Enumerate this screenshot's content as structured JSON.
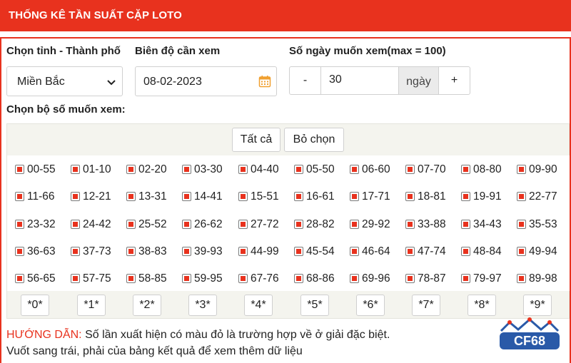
{
  "header": {
    "title": "THỐNG KÊ TẦN SUẤT CẶP LOTO"
  },
  "form": {
    "province_label": "Chọn tỉnh - Thành phố",
    "province_value": "Miền Bắc",
    "range_label": "Biên độ cần xem",
    "date_value": "08-02-2023",
    "days_label": "Số ngày muốn xem(max = 100)",
    "minus_label": "-",
    "days_value": "30",
    "days_unit": "ngày",
    "plus_label": "+"
  },
  "picker": {
    "title": "Chọn bộ số muốn xem:",
    "select_all": "Tất cả",
    "deselect": "Bỏ chọn",
    "rows": [
      [
        "00-55",
        "01-10",
        "02-20",
        "03-30",
        "04-40",
        "05-50",
        "06-60",
        "07-70",
        "08-80",
        "09-90"
      ],
      [
        "11-66",
        "12-21",
        "13-31",
        "14-41",
        "15-51",
        "16-61",
        "17-71",
        "18-81",
        "19-91",
        "22-77"
      ],
      [
        "23-32",
        "24-42",
        "25-52",
        "26-62",
        "27-72",
        "28-82",
        "29-92",
        "33-88",
        "34-43",
        "35-53"
      ],
      [
        "36-63",
        "37-73",
        "38-83",
        "39-93",
        "44-99",
        "45-54",
        "46-64",
        "47-74",
        "48-84",
        "49-94"
      ],
      [
        "56-65",
        "57-75",
        "58-85",
        "59-95",
        "67-76",
        "68-86",
        "69-96",
        "78-87",
        "79-97",
        "89-98"
      ]
    ],
    "tails": [
      "*0*",
      "*1*",
      "*2*",
      "*3*",
      "*4*",
      "*5*",
      "*6*",
      "*7*",
      "*8*",
      "*9*"
    ]
  },
  "guide": {
    "heading": "HƯỚNG DẪN:",
    "line1": "Số lần xuất hiện có màu đỏ là trường hợp về ở giải đặc biệt.",
    "line2": "Vuốt sang trái, phải của bảng kết quả để xem thêm dữ liệu"
  },
  "brand": {
    "logo_text": "CF68",
    "accent": "#e8321e"
  }
}
